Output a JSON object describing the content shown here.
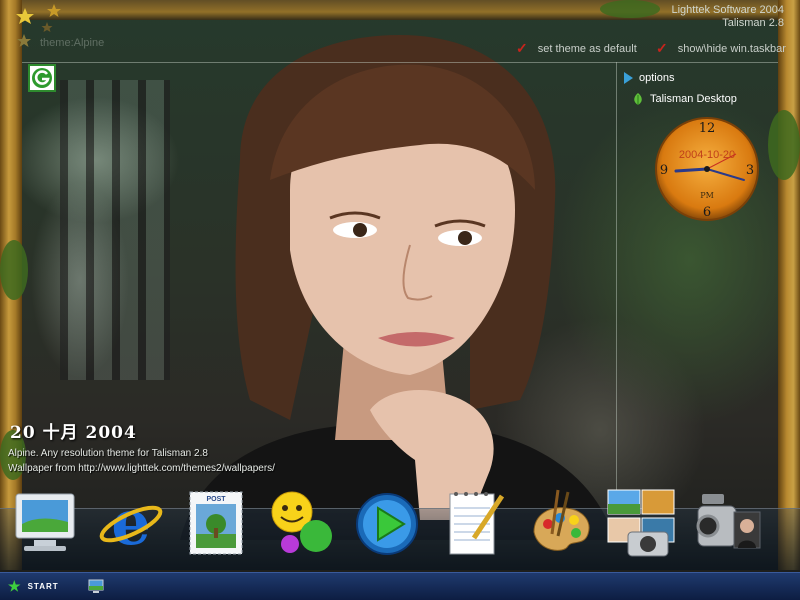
{
  "header": {
    "brand_line1": "Lighttek Software 2004",
    "brand_line2": "Talisman 2.8",
    "theme_ghost": "theme:Alpine",
    "set_theme_label": "set theme as default",
    "toggle_taskbar_label": "show\\hide win.taskbar"
  },
  "panel": {
    "options_label": "options",
    "desktop_label": "Talisman Desktop",
    "clock_date": "2004-10-20",
    "clock_ampm": "PM",
    "clock_numbers": [
      "12",
      "3",
      "6",
      "9"
    ]
  },
  "info": {
    "date_text": "20  十月  2004",
    "line1": "Alpine. Any resolution theme for Talisman 2.8",
    "line2": "Wallpaper from http://www.lighttek.com/themes2/wallpapers/"
  },
  "dock": {
    "items": [
      "my-computer",
      "internet-explorer",
      "mail-stamp",
      "messenger",
      "media-player",
      "notepad",
      "paint",
      "photo-gallery",
      "video-camera"
    ]
  },
  "taskbar": {
    "start_label": "START"
  },
  "colors": {
    "taskbar": "#0d1d42",
    "check": "#c8241c",
    "accent_blue": "#3aa0d8",
    "frame_wood": "#b98a30"
  }
}
